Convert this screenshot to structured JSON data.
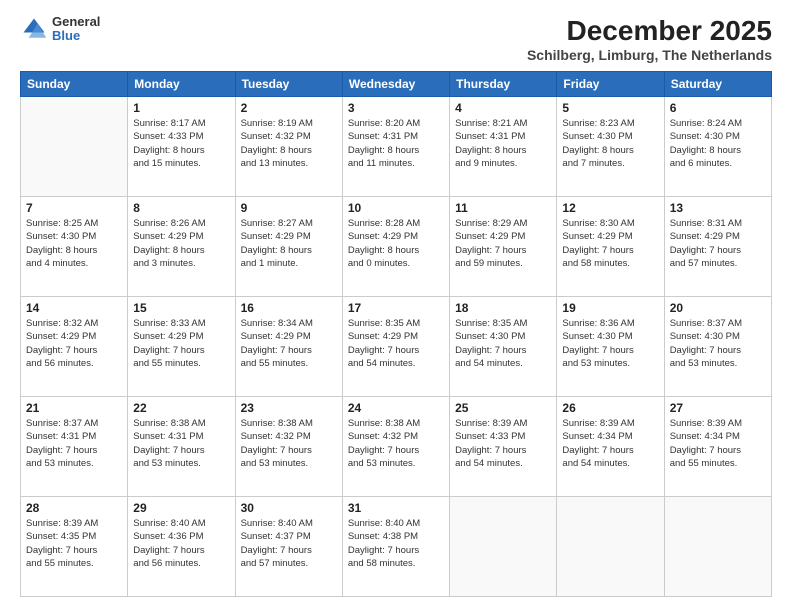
{
  "logo": {
    "general": "General",
    "blue": "Blue"
  },
  "header": {
    "month": "December 2025",
    "location": "Schilberg, Limburg, The Netherlands"
  },
  "weekdays": [
    "Sunday",
    "Monday",
    "Tuesday",
    "Wednesday",
    "Thursday",
    "Friday",
    "Saturday"
  ],
  "weeks": [
    [
      {
        "day": "",
        "info": ""
      },
      {
        "day": "1",
        "info": "Sunrise: 8:17 AM\nSunset: 4:33 PM\nDaylight: 8 hours\nand 15 minutes."
      },
      {
        "day": "2",
        "info": "Sunrise: 8:19 AM\nSunset: 4:32 PM\nDaylight: 8 hours\nand 13 minutes."
      },
      {
        "day": "3",
        "info": "Sunrise: 8:20 AM\nSunset: 4:31 PM\nDaylight: 8 hours\nand 11 minutes."
      },
      {
        "day": "4",
        "info": "Sunrise: 8:21 AM\nSunset: 4:31 PM\nDaylight: 8 hours\nand 9 minutes."
      },
      {
        "day": "5",
        "info": "Sunrise: 8:23 AM\nSunset: 4:30 PM\nDaylight: 8 hours\nand 7 minutes."
      },
      {
        "day": "6",
        "info": "Sunrise: 8:24 AM\nSunset: 4:30 PM\nDaylight: 8 hours\nand 6 minutes."
      }
    ],
    [
      {
        "day": "7",
        "info": "Sunrise: 8:25 AM\nSunset: 4:30 PM\nDaylight: 8 hours\nand 4 minutes."
      },
      {
        "day": "8",
        "info": "Sunrise: 8:26 AM\nSunset: 4:29 PM\nDaylight: 8 hours\nand 3 minutes."
      },
      {
        "day": "9",
        "info": "Sunrise: 8:27 AM\nSunset: 4:29 PM\nDaylight: 8 hours\nand 1 minute."
      },
      {
        "day": "10",
        "info": "Sunrise: 8:28 AM\nSunset: 4:29 PM\nDaylight: 8 hours\nand 0 minutes."
      },
      {
        "day": "11",
        "info": "Sunrise: 8:29 AM\nSunset: 4:29 PM\nDaylight: 7 hours\nand 59 minutes."
      },
      {
        "day": "12",
        "info": "Sunrise: 8:30 AM\nSunset: 4:29 PM\nDaylight: 7 hours\nand 58 minutes."
      },
      {
        "day": "13",
        "info": "Sunrise: 8:31 AM\nSunset: 4:29 PM\nDaylight: 7 hours\nand 57 minutes."
      }
    ],
    [
      {
        "day": "14",
        "info": "Sunrise: 8:32 AM\nSunset: 4:29 PM\nDaylight: 7 hours\nand 56 minutes."
      },
      {
        "day": "15",
        "info": "Sunrise: 8:33 AM\nSunset: 4:29 PM\nDaylight: 7 hours\nand 55 minutes."
      },
      {
        "day": "16",
        "info": "Sunrise: 8:34 AM\nSunset: 4:29 PM\nDaylight: 7 hours\nand 55 minutes."
      },
      {
        "day": "17",
        "info": "Sunrise: 8:35 AM\nSunset: 4:29 PM\nDaylight: 7 hours\nand 54 minutes."
      },
      {
        "day": "18",
        "info": "Sunrise: 8:35 AM\nSunset: 4:30 PM\nDaylight: 7 hours\nand 54 minutes."
      },
      {
        "day": "19",
        "info": "Sunrise: 8:36 AM\nSunset: 4:30 PM\nDaylight: 7 hours\nand 53 minutes."
      },
      {
        "day": "20",
        "info": "Sunrise: 8:37 AM\nSunset: 4:30 PM\nDaylight: 7 hours\nand 53 minutes."
      }
    ],
    [
      {
        "day": "21",
        "info": "Sunrise: 8:37 AM\nSunset: 4:31 PM\nDaylight: 7 hours\nand 53 minutes."
      },
      {
        "day": "22",
        "info": "Sunrise: 8:38 AM\nSunset: 4:31 PM\nDaylight: 7 hours\nand 53 minutes."
      },
      {
        "day": "23",
        "info": "Sunrise: 8:38 AM\nSunset: 4:32 PM\nDaylight: 7 hours\nand 53 minutes."
      },
      {
        "day": "24",
        "info": "Sunrise: 8:38 AM\nSunset: 4:32 PM\nDaylight: 7 hours\nand 53 minutes."
      },
      {
        "day": "25",
        "info": "Sunrise: 8:39 AM\nSunset: 4:33 PM\nDaylight: 7 hours\nand 54 minutes."
      },
      {
        "day": "26",
        "info": "Sunrise: 8:39 AM\nSunset: 4:34 PM\nDaylight: 7 hours\nand 54 minutes."
      },
      {
        "day": "27",
        "info": "Sunrise: 8:39 AM\nSunset: 4:34 PM\nDaylight: 7 hours\nand 55 minutes."
      }
    ],
    [
      {
        "day": "28",
        "info": "Sunrise: 8:39 AM\nSunset: 4:35 PM\nDaylight: 7 hours\nand 55 minutes."
      },
      {
        "day": "29",
        "info": "Sunrise: 8:40 AM\nSunset: 4:36 PM\nDaylight: 7 hours\nand 56 minutes."
      },
      {
        "day": "30",
        "info": "Sunrise: 8:40 AM\nSunset: 4:37 PM\nDaylight: 7 hours\nand 57 minutes."
      },
      {
        "day": "31",
        "info": "Sunrise: 8:40 AM\nSunset: 4:38 PM\nDaylight: 7 hours\nand 58 minutes."
      },
      {
        "day": "",
        "info": ""
      },
      {
        "day": "",
        "info": ""
      },
      {
        "day": "",
        "info": ""
      }
    ]
  ]
}
